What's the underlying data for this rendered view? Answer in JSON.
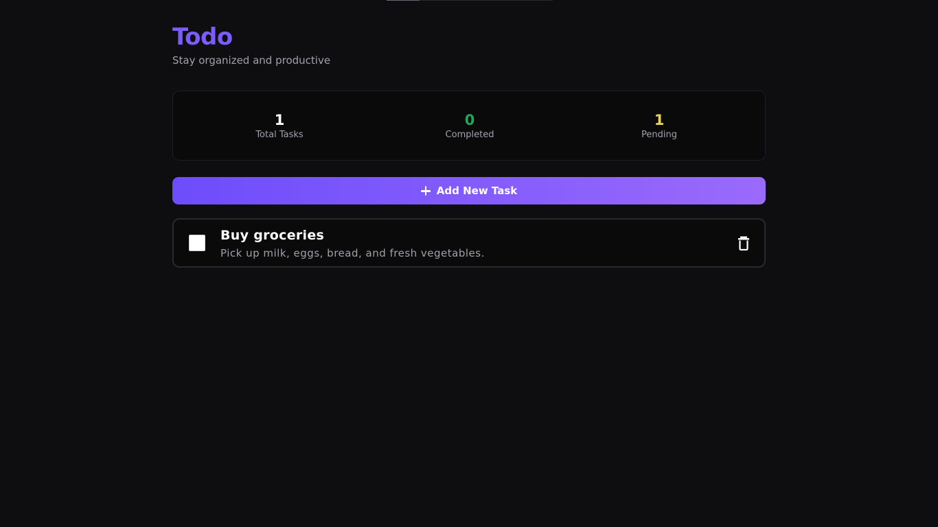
{
  "header": {
    "title": "Todo",
    "subtitle": "Stay organized and productive"
  },
  "stats": {
    "total": {
      "value": "1",
      "label": "Total Tasks",
      "color": "#ffffff"
    },
    "completed": {
      "value": "0",
      "label": "Completed",
      "color": "#22a559"
    },
    "pending": {
      "value": "1",
      "label": "Pending",
      "color": "#f2d544"
    }
  },
  "actions": {
    "add_label": "Add New Task",
    "add_icon": "plus-icon"
  },
  "tasks": [
    {
      "title": "Buy groceries",
      "description": "Pick up milk, eggs, bread, and fresh vegetables.",
      "completed": false,
      "delete_icon": "trash-icon"
    }
  ],
  "theme": {
    "accent": "#7c5cff",
    "gradient_start": "#6d4dfb",
    "gradient_end": "#9a6afc",
    "background": "#0e0e10"
  }
}
